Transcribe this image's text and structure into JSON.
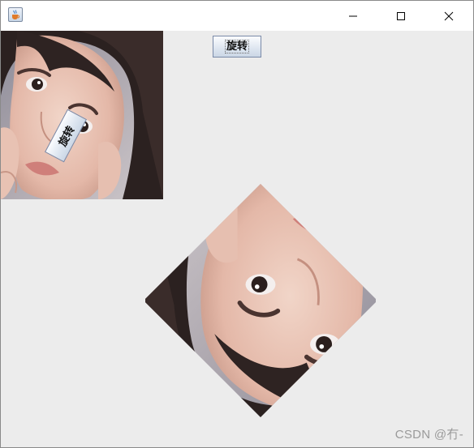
{
  "window": {
    "icons": {
      "app": "java-cup-icon",
      "minimize": "minimize-icon",
      "maximize": "maximize-icon",
      "close": "close-icon"
    }
  },
  "toolbar": {
    "rotate_label": "旋转"
  },
  "canvas": {
    "rotated_button_label": "旋转",
    "watermark": "CSDN @冇-",
    "images": [
      {
        "id": "original-photo",
        "rotation_deg": 0
      },
      {
        "id": "rotated-photo",
        "rotation_deg": 135
      }
    ]
  },
  "colors": {
    "content_bg": "#ececec",
    "button_border": "#7a8aa8"
  }
}
